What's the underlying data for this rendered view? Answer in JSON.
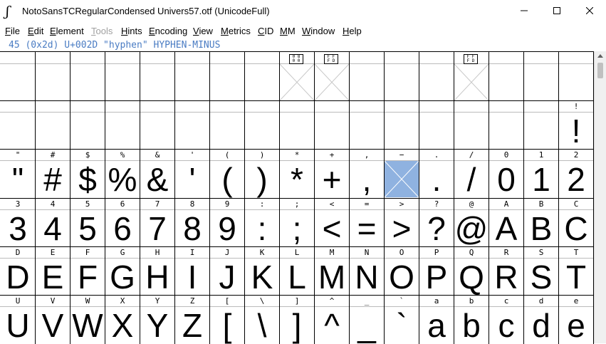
{
  "window": {
    "title": "NotoSansTCRegularCondensed  Univers57.otf (UnicodeFull)",
    "app_icon": "fontforge-icon",
    "controls": [
      "minimize",
      "maximize",
      "close"
    ]
  },
  "menu": [
    {
      "label": "File",
      "ul": "F",
      "rest": "ile",
      "disabled": false
    },
    {
      "label": "Edit",
      "ul": "E",
      "rest": "dit",
      "disabled": false
    },
    {
      "label": "Element",
      "ul": "E",
      "rest": "lement",
      "disabled": false
    },
    {
      "label": "Tools",
      "ul": "T",
      "rest": "ools",
      "disabled": true
    },
    {
      "label": "Hints",
      "ul": "H",
      "pre": "",
      "rest": "ints",
      "disabled": false
    },
    {
      "label": "Encoding",
      "ul": "E",
      "rest": "ncoding",
      "disabled": false
    },
    {
      "label": "View",
      "ul": "V",
      "rest": "iew",
      "disabled": false
    },
    {
      "label": "Metrics",
      "ul": "M",
      "rest": "etrics",
      "disabled": false
    },
    {
      "label": "CID",
      "ul": "C",
      "rest": "ID",
      "disabled": false
    },
    {
      "label": "MM",
      "ul": "M",
      "rest": "M",
      "disabled": false
    },
    {
      "label": "Window",
      "ul": "W",
      "rest": "indow",
      "disabled": false
    },
    {
      "label": "Help",
      "ul": "H",
      "rest": "elp",
      "disabled": false
    }
  ],
  "info": "45 (0x2d) U+002D \"hyphen\" HYPHEN-MINUS",
  "colors": {
    "info_text": "#4a7cc3",
    "selection": "#8fb2e0"
  },
  "rows": [
    {
      "labels": [
        "",
        "",
        "",
        "",
        "",
        "",
        "",
        "",
        "",
        "",
        "",
        "",
        "",
        "",
        "",
        "",
        ""
      ],
      "glyphs": [
        "",
        "",
        "",
        "",
        "",
        "",
        "",
        "",
        "",
        "",
        "",
        "",
        "",
        "",
        "",
        "",
        ""
      ],
      "missing": {
        "8": "0 8\n0 0",
        "9": "F F\nF D",
        "13": "F F\nF D"
      }
    },
    {
      "labels": [
        "",
        "",
        "",
        "",
        "",
        "",
        "",
        "",
        "",
        "",
        "",
        "",
        "",
        "",
        "",
        "",
        "!"
      ],
      "glyphs": [
        "",
        "",
        "",
        "",
        "",
        "",
        "",
        "",
        "",
        "",
        "",
        "",
        "",
        "",
        "",
        "",
        "!"
      ],
      "missing": {}
    },
    {
      "labels": [
        "\"",
        "#",
        "$",
        "%",
        "&",
        "'",
        "(",
        ")",
        "*",
        "+",
        ",",
        "−",
        ".",
        "/",
        "0",
        "1",
        "2"
      ],
      "glyphs": [
        "\"",
        "#",
        "$",
        "%",
        "&",
        "'",
        "(",
        ")",
        "*",
        "+",
        ",",
        "",
        ".",
        "/",
        "0",
        "1",
        "2"
      ],
      "missing": {},
      "selected": 11
    },
    {
      "labels": [
        "3",
        "4",
        "5",
        "6",
        "7",
        "8",
        "9",
        ":",
        ";",
        "<",
        "=",
        ">",
        "?",
        "@",
        "A",
        "B",
        "C"
      ],
      "glyphs": [
        "3",
        "4",
        "5",
        "6",
        "7",
        "8",
        "9",
        ":",
        ";",
        "<",
        "=",
        ">",
        "?",
        "@",
        "A",
        "B",
        "C"
      ],
      "missing": {}
    },
    {
      "labels": [
        "D",
        "E",
        "F",
        "G",
        "H",
        "I",
        "J",
        "K",
        "L",
        "M",
        "N",
        "O",
        "P",
        "Q",
        "R",
        "S",
        "T"
      ],
      "glyphs": [
        "D",
        "E",
        "F",
        "G",
        "H",
        "I",
        "J",
        "K",
        "L",
        "M",
        "N",
        "O",
        "P",
        "Q",
        "R",
        "S",
        "T"
      ],
      "missing": {}
    },
    {
      "labels": [
        "U",
        "V",
        "W",
        "X",
        "Y",
        "Z",
        "[",
        "\\",
        "]",
        "^",
        "_",
        "`",
        "a",
        "b",
        "c",
        "d",
        "e"
      ],
      "glyphs": [
        "U",
        "V",
        "W",
        "X",
        "Y",
        "Z",
        "[",
        "\\",
        "]",
        "^",
        "_",
        "`",
        "a",
        "b",
        "c",
        "d",
        "e"
      ],
      "missing": {}
    }
  ]
}
